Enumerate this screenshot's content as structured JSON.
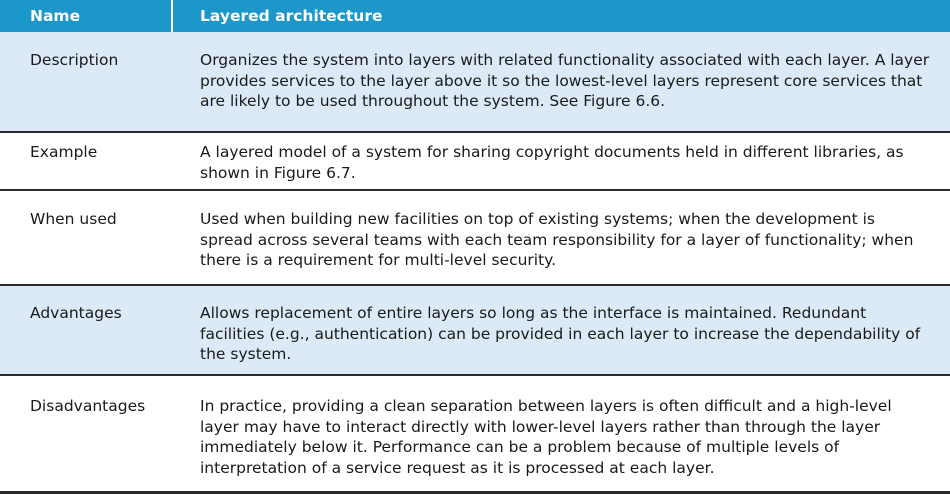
{
  "header": {
    "name_label": "Name",
    "title": "Layered architecture"
  },
  "rows": [
    {
      "label": "Description",
      "text": "Organizes the system into layers with related functionality associated with each layer. A layer provides services to the layer above it so the lowest-level layers represent core services that are likely to be used throughout the system. See Figure 6.6."
    },
    {
      "label": "Example",
      "text": "A layered model of a system for sharing copyright documents held in different libraries, as shown in Figure 6.7."
    },
    {
      "label": "When used",
      "text": "Used when building new facilities on top of existing systems; when the development is spread across several teams with each team responsibility for a layer of functionality; when there is a requirement for multi-level security."
    },
    {
      "label": "Advantages",
      "text": "Allows replacement of entire layers so long as the interface is maintained. Redundant facilities (e.g., authentication) can be provided in each layer to increase the dependability of the system."
    },
    {
      "label": "Disadvantages",
      "text": "In practice, providing a clean separation between layers is often difficult and a high-level layer may have to interact directly with lower-level layers rather than through the layer immediately below it. Performance can be a problem because of multiple levels of interpretation of a service request as it is processed at each layer."
    }
  ],
  "colors": {
    "header_bg": "#1b97cc",
    "shaded_row_bg": "#dbeaf6",
    "rule": "#2a2a2a"
  }
}
